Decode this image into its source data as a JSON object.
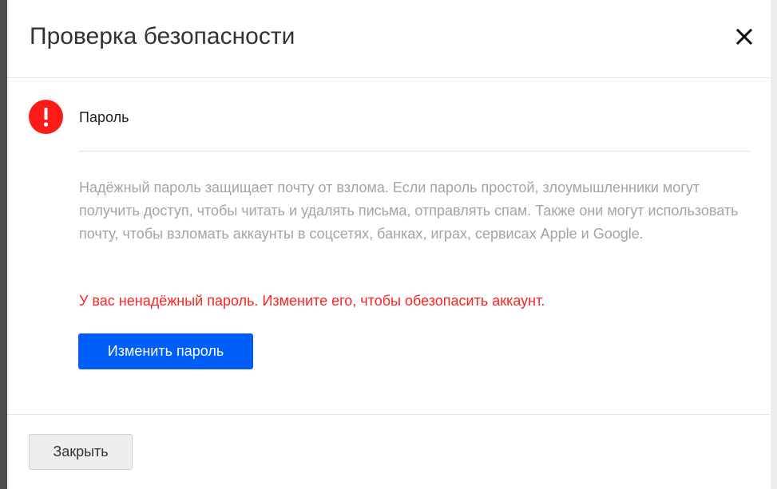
{
  "dialog": {
    "title": "Проверка безопасности",
    "close_icon": "close-icon"
  },
  "section": {
    "icon": "alert-icon",
    "icon_color": "#ff1a1a",
    "label": "Пароль",
    "description": "Надёжный пароль защищает почту от взлома. Если пароль простой, злоумышленники могут получить доступ, чтобы читать и удалять письма, отправлять спам. Также они могут использовать почту, чтобы взломать аккаунты в соцсетях, банках, играх, сервисах Apple и Google.",
    "warning": "У вас ненадёжный пароль. Измените его, чтобы обезопасить аккаунт.",
    "warning_color": "#ff2020",
    "action_label": "Изменить пароль",
    "action_color": "#005ff9"
  },
  "footer": {
    "close_label": "Закрыть"
  }
}
